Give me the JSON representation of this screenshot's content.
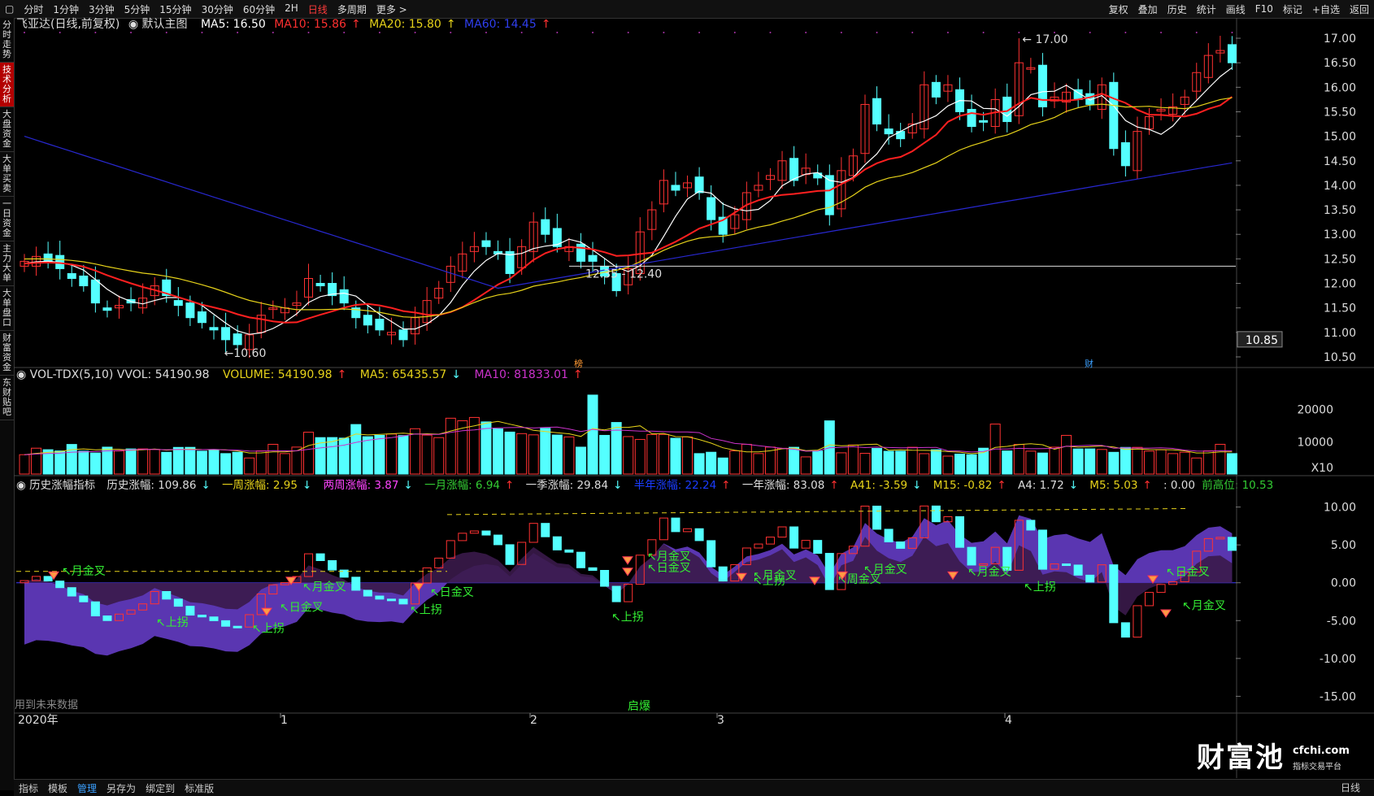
{
  "toolbar": {
    "periods": [
      "分时",
      "1分钟",
      "3分钟",
      "5分钟",
      "15分钟",
      "30分钟",
      "60分钟",
      "2H",
      "日线",
      "多周期",
      "更多 >"
    ],
    "active_period": "日线",
    "right": [
      "复权",
      "叠加",
      "历史",
      "统计",
      "画线",
      "F10",
      "标记",
      "+自选",
      "返回"
    ]
  },
  "sidebar": {
    "tabs": [
      "分时走势",
      "技术分析",
      "大盘资金",
      "大单买卖",
      "一日资金",
      "主力大单",
      "大单盘口",
      "财富资金",
      "东财贴吧"
    ],
    "active": "技术分析"
  },
  "main_legend": {
    "title": "飞亚达(日线,前复权)",
    "template": "默认主图",
    "ma5": "MA5: 16.50",
    "ma10": "MA10: 15.86",
    "ma20": "MA20: 15.80",
    "ma60": "MA60: 14.45"
  },
  "vol_legend": {
    "name": "VOL-TDX(5,10) VVOL: 54190.98",
    "volume": "VOLUME: 54190.98",
    "ma5": "MA5: 65435.57",
    "ma10": "MA10: 81833.01"
  },
  "ind_legend": {
    "name": "历史涨幅指标",
    "hist": "历史涨幅: 109.86",
    "w1": "一周涨幅: 2.95",
    "w2": "两周涨幅: 3.87",
    "m1": "一月涨幅: 6.94",
    "q1": "一季涨幅: 29.84",
    "h1": "半年涨幅: 22.24",
    "y1": "一年涨幅: 83.08",
    "a41": "A41: -3.59",
    "m15": "M15: -0.82",
    "a4": "A4: 1.72",
    "m5": "M5: 5.03",
    "zero": ": 0.00",
    "prev_high": "前高位: 10.53"
  },
  "price_axis": [
    "17.00",
    "16.50",
    "16.00",
    "15.50",
    "15.00",
    "14.50",
    "14.00",
    "13.50",
    "13.00",
    "12.50",
    "12.00",
    "11.50",
    "11.00",
    "10.50"
  ],
  "current_price": "10.85",
  "vol_axis": [
    "20000",
    "10000",
    "X10"
  ],
  "ind_axis": [
    "10.00",
    "5.00",
    "0.00",
    "-5.00",
    "-10.00",
    "-15.00"
  ],
  "annotations": {
    "high": "17.00",
    "low": "10.60",
    "hline": "12.35 - 12.40",
    "bang": "榜",
    "cai": "财"
  },
  "signals": {
    "yue": "月金叉",
    "ri": "日金叉",
    "zhou": "周金叉",
    "shang": "上拐"
  },
  "footer_notes": {
    "future": "用到未来数据",
    "qibao": "启爆"
  },
  "xaxis": {
    "year": "2020年",
    "months": [
      "1",
      "2",
      "3",
      "4"
    ]
  },
  "statusbar": {
    "items": [
      "指标",
      "模板",
      "管理",
      "另存为",
      "绑定到",
      "标准版"
    ],
    "active": "管理",
    "period": "日线"
  },
  "watermark": {
    "brand": "财富池",
    "site": "cfchi.com",
    "slogan": "指标交易平台"
  },
  "colors": {
    "up": "#ff3232",
    "down": "#54ffff",
    "ma5": "#ffffff",
    "ma10": "#ff2020",
    "ma20": "#e6d21a",
    "ma60": "#2828d0",
    "vol_ma5": "#e6d21a",
    "vol_ma10": "#cc33cc"
  },
  "chart_data": {
    "type": "candlestick",
    "closes": [
      12.45,
      12.55,
      12.45,
      12.3,
      12.1,
      11.95,
      11.6,
      11.45,
      11.55,
      11.6,
      11.7,
      11.95,
      11.75,
      11.55,
      11.3,
      11.2,
      11.05,
      10.85,
      10.75,
      10.95,
      11.35,
      11.5,
      11.5,
      11.6,
      12.1,
      11.95,
      11.75,
      11.6,
      11.3,
      11.15,
      11.05,
      11.0,
      10.85,
      11.3,
      11.65,
      11.9,
      12.35,
      12.6,
      12.75,
      12.75,
      12.6,
      12.2,
      12.75,
      13.25,
      13.0,
      12.75,
      12.75,
      12.45,
      12.45,
      12.15,
      11.85,
      12.3,
      13.05,
      13.5,
      14.1,
      13.9,
      14.05,
      13.85,
      13.3,
      13.0,
      13.4,
      13.85,
      14.0,
      14.2,
      14.5,
      14.1,
      14.35,
      14.15,
      13.4,
      14.3,
      14.6,
      15.65,
      15.25,
      15.05,
      14.95,
      15.25,
      16.05,
      15.8,
      16.05,
      15.5,
      15.2,
      15.3,
      15.75,
      15.3,
      16.5,
      16.4,
      15.6,
      15.8,
      15.9,
      15.75,
      15.65,
      16.05,
      14.75,
      14.4,
      15.1,
      15.4,
      15.55,
      15.6,
      15.8,
      16.3,
      16.65,
      16.75,
      16.5
    ],
    "vol_ma5_note": "volume bars rendered from series",
    "ylim": [
      10.35,
      17.15
    ]
  }
}
